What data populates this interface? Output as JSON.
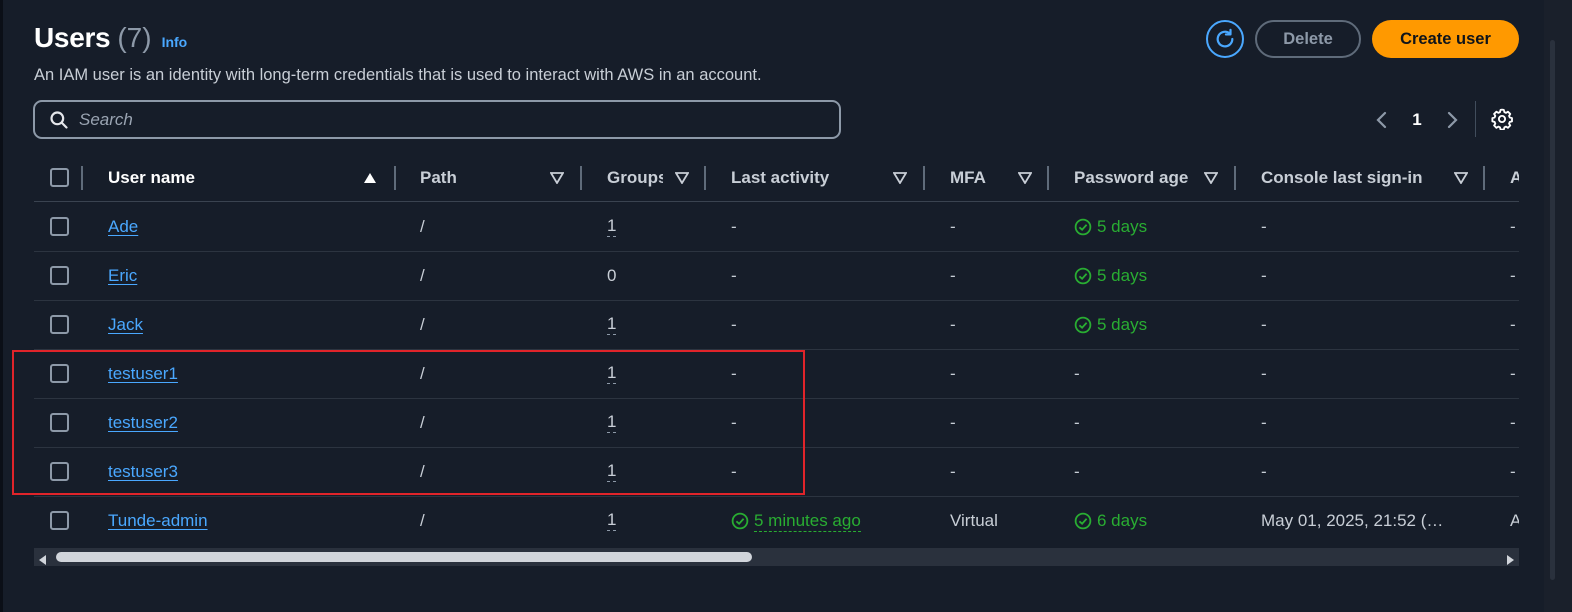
{
  "header": {
    "title": "Users",
    "count": "(7)",
    "info": "Info"
  },
  "description": "An IAM user is an identity with long-term credentials that is used to interact with AWS in an account.",
  "toolbar": {
    "delete_label": "Delete",
    "create_label": "Create user"
  },
  "search": {
    "placeholder": "Search",
    "value": ""
  },
  "pagination": {
    "current_page": "1"
  },
  "table": {
    "columns": [
      {
        "label": "User name",
        "sort": "ascending"
      },
      {
        "label": "Path",
        "sort": "none"
      },
      {
        "label": "Groups",
        "sort": "none"
      },
      {
        "label": "Last activity",
        "sort": "none"
      },
      {
        "label": "MFA",
        "sort": "none"
      },
      {
        "label": "Password age",
        "sort": "none"
      },
      {
        "label": "Console last sign-in",
        "sort": "none"
      },
      {
        "label": "A",
        "sort": "none"
      }
    ],
    "rows": [
      {
        "username": "Ade",
        "path": "/",
        "groups": "1",
        "last_activity": "-",
        "mfa": "-",
        "password_age": "5 days",
        "console_sign_in": "-",
        "extra": "-"
      },
      {
        "username": "Eric",
        "path": "/",
        "groups": "0",
        "last_activity": "-",
        "mfa": "-",
        "password_age": "5 days",
        "console_sign_in": "-",
        "extra": "-"
      },
      {
        "username": "Jack",
        "path": "/",
        "groups": "1",
        "last_activity": "-",
        "mfa": "-",
        "password_age": "5 days",
        "console_sign_in": "-",
        "extra": "-"
      },
      {
        "username": "testuser1",
        "path": "/",
        "groups": "1",
        "last_activity": "-",
        "mfa": "-",
        "password_age": "-",
        "console_sign_in": "-",
        "extra": "-"
      },
      {
        "username": "testuser2",
        "path": "/",
        "groups": "1",
        "last_activity": "-",
        "mfa": "-",
        "password_age": "-",
        "console_sign_in": "-",
        "extra": "-"
      },
      {
        "username": "testuser3",
        "path": "/",
        "groups": "1",
        "last_activity": "-",
        "mfa": "-",
        "password_age": "-",
        "console_sign_in": "-",
        "extra": "-"
      },
      {
        "username": "Tunde-admin",
        "path": "/",
        "groups": "1",
        "last_activity": "5 minutes ago",
        "mfa": "Virtual",
        "password_age": "6 days",
        "console_sign_in": "May 01, 2025, 21:52 (…",
        "extra": "A"
      }
    ]
  },
  "colors": {
    "accent": "#4aa8ff",
    "primary_button": "#ff9900",
    "success": "#29ad32",
    "highlight": "#e0242a",
    "background": "#161d29"
  },
  "icons": {
    "refresh": "refresh-icon",
    "search": "search-icon",
    "settings": "gear-icon",
    "status": "check-circle-icon"
  }
}
